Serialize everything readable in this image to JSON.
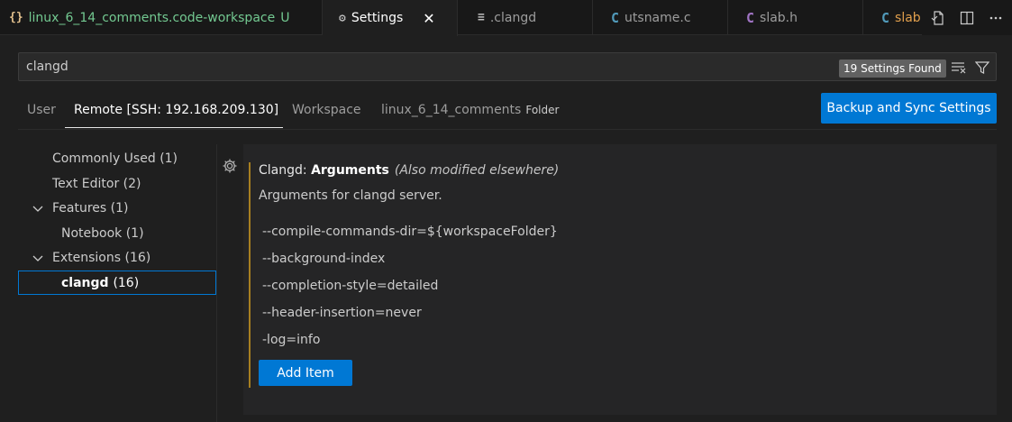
{
  "tabs": [
    {
      "icon": "{}",
      "label": "linux_6_14_comments.code-workspace",
      "badge": "U"
    },
    {
      "icon": "⚙",
      "label": "Settings",
      "close": "✕"
    },
    {
      "icon": "≡",
      "label": ".clangd"
    },
    {
      "icon": "C",
      "label": "utsname.c"
    },
    {
      "icon": "C",
      "label": "slab.h"
    },
    {
      "icon": "C",
      "label": "slab.c"
    }
  ],
  "tab_actions": [
    "open-settings-json-icon",
    "split-editor-icon",
    "more-actions-icon"
  ],
  "search": {
    "value": "clangd",
    "found": "19 Settings Found"
  },
  "scopes": {
    "user": "User",
    "remote": "Remote [SSH: 192.168.209.130]",
    "workspace": "Workspace",
    "folder": "linux_6_14_comments",
    "folder_hint": "Folder"
  },
  "sync_button": "Backup and Sync Settings",
  "toc": {
    "commonly_used": {
      "label": "Commonly Used",
      "count": "(1)"
    },
    "text_editor": {
      "label": "Text Editor",
      "count": "(2)"
    },
    "features": {
      "label": "Features",
      "count": "(1)"
    },
    "notebook": {
      "label": "Notebook",
      "count": "(1)"
    },
    "extensions": {
      "label": "Extensions",
      "count": "(16)"
    },
    "clangd": {
      "label": "clangd",
      "count": "(16)"
    }
  },
  "setting": {
    "category": "Clangd:",
    "name": "Arguments",
    "modified": "(Also modified elsewhere)",
    "description": "Arguments for clangd server.",
    "items": [
      "--compile-commands-dir=${workspaceFolder}",
      "--background-index",
      "--completion-style=detailed",
      "--header-insertion=never",
      "-log=info"
    ],
    "add_button": "Add Item"
  },
  "colors": {
    "accent": "#0078d4",
    "modified_bar": "#a67f21",
    "untracked": "#73c991"
  }
}
